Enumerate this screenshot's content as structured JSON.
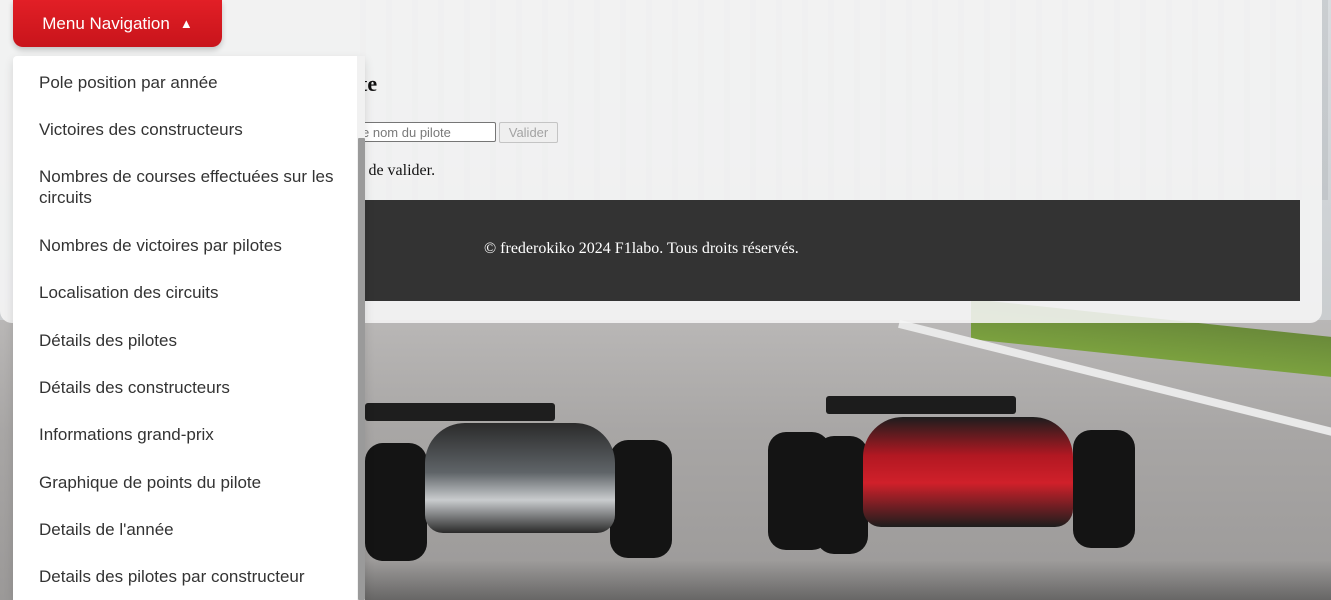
{
  "menu": {
    "button_label": "Menu Navigation",
    "button_arrow": "▲",
    "items": [
      {
        "label": "Pole position par année"
      },
      {
        "label": "Victoires des constructeurs"
      },
      {
        "label": "Nombres de courses effectuées sur les circuits"
      },
      {
        "label": "Nombres de victoires par pilotes"
      },
      {
        "label": "Localisation des circuits"
      },
      {
        "label": "Détails des pilotes"
      },
      {
        "label": "Détails des constructeurs"
      },
      {
        "label": "Informations grand-prix"
      },
      {
        "label": "Graphique de points du pilote"
      },
      {
        "label": "Details de l'année"
      },
      {
        "label": "Details des pilotes par constructeur"
      }
    ]
  },
  "main": {
    "title_visible": "te",
    "search_placeholder_visible": "e nom du pilote",
    "submit_label": "Valider",
    "instruction_visible": "t de valider."
  },
  "footer": {
    "copyright": "© frederokiko 2024 F1labo. Tous droits réservés."
  },
  "colors": {
    "menu_button": "#d71a21",
    "footer_bg": "#333333",
    "menu_text": "#333333"
  }
}
